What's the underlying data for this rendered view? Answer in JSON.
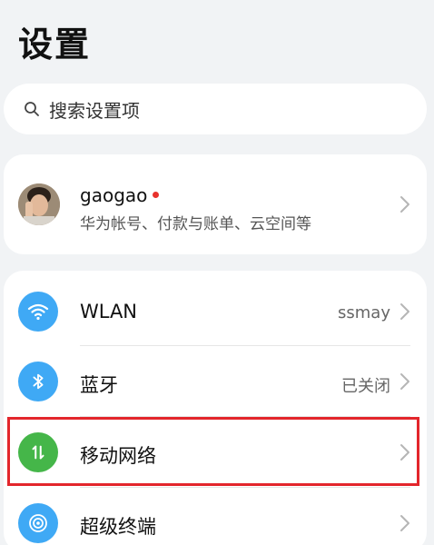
{
  "header": {
    "title": "设置"
  },
  "search": {
    "placeholder": "搜索设置项"
  },
  "account": {
    "name": "gaogao",
    "subtitle": "华为帐号、付款与账单、云空间等"
  },
  "settings": {
    "items": [
      {
        "label": "WLAN",
        "value": "ssmay",
        "icon": "wifi-icon",
        "color": "#3fa9f5"
      },
      {
        "label": "蓝牙",
        "value": "已关闭",
        "icon": "bluetooth-icon",
        "color": "#3fa9f5"
      },
      {
        "label": "移动网络",
        "value": "",
        "icon": "mobile-data-icon",
        "color": "#45b649"
      },
      {
        "label": "超级终端",
        "value": "",
        "icon": "super-device-icon",
        "color": "#3fa9f5"
      }
    ]
  },
  "highlight_color": "#e3262c"
}
